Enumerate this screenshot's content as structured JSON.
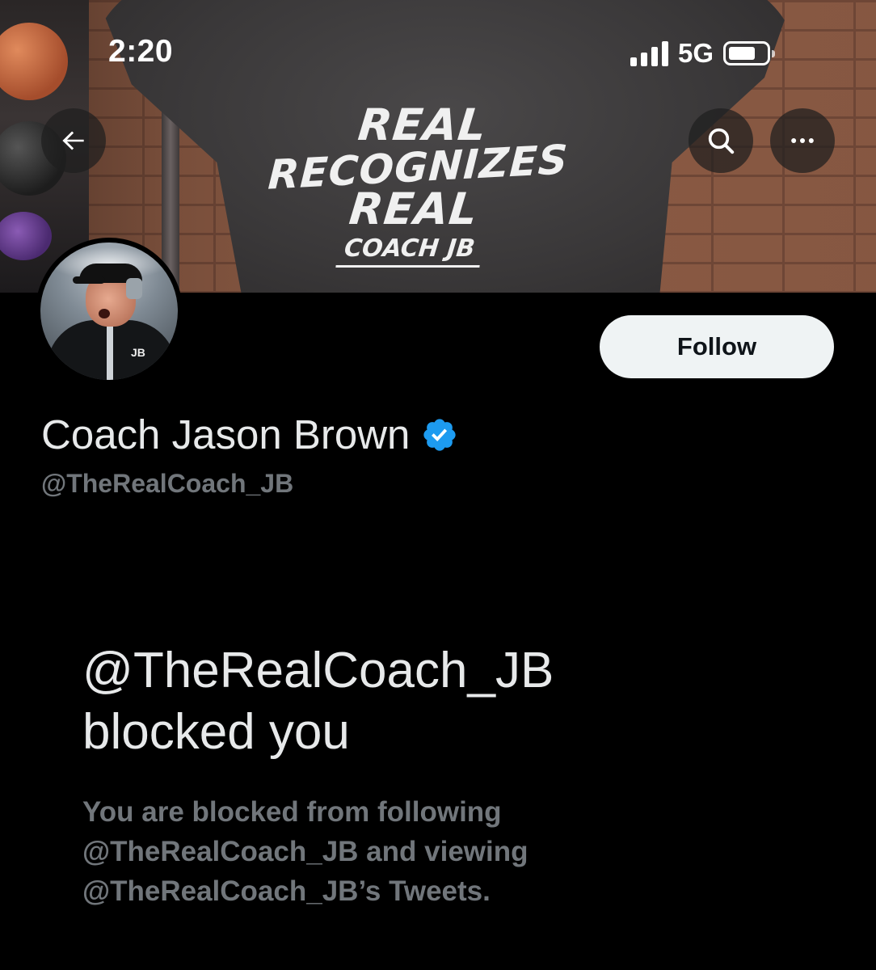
{
  "status_bar": {
    "time": "2:20",
    "network": "5G",
    "battery_level": 0.72
  },
  "banner": {
    "shirt_text": [
      "REAL",
      "RECOGNIZES",
      "REAL",
      "COACH JB"
    ]
  },
  "header": {
    "back_icon": "arrow-left-icon",
    "search_icon": "search-icon",
    "more_icon": "more-horizontal-icon"
  },
  "profile": {
    "display_name": "Coach Jason Brown",
    "verified": true,
    "verified_color": "#1d9bf0",
    "handle": "@TheRealCoach_JB",
    "avatar_logo_text": "JB",
    "follow_label": "Follow"
  },
  "blocked": {
    "title_line1": "@TheRealCoach_JB",
    "title_line2": "blocked you",
    "desc_line1": "You are blocked from following",
    "desc_line2": "@TheRealCoach_JB and viewing",
    "desc_line3": "@TheRealCoach_JB’s Tweets."
  },
  "colors": {
    "background": "#000000",
    "primary_text": "#e7e9ea",
    "secondary_text": "#71767b",
    "follow_bg": "#eff3f4"
  }
}
